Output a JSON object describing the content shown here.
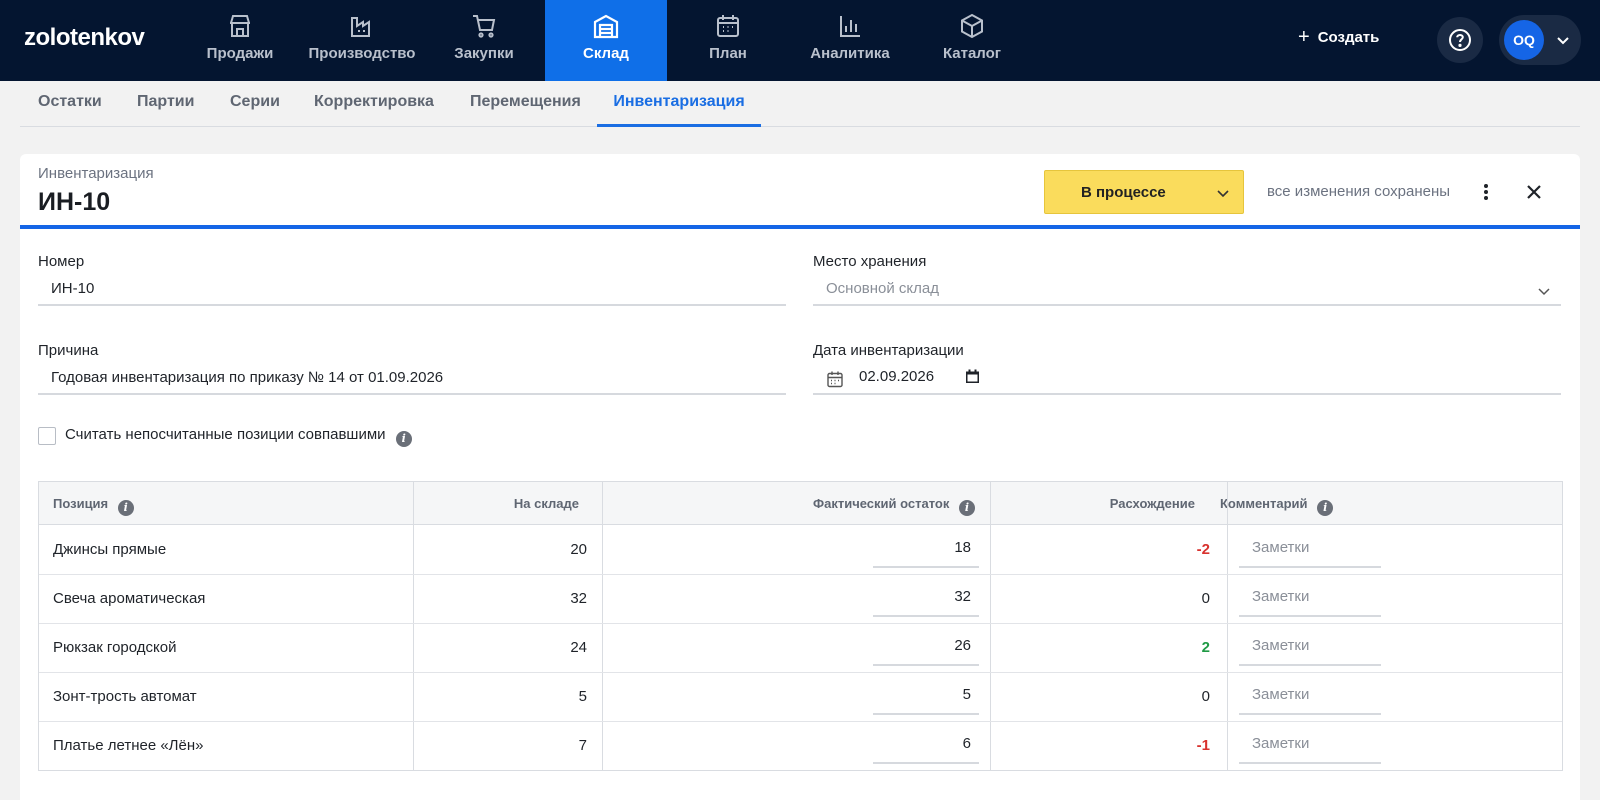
{
  "brand": "zolotenkov",
  "nav": [
    {
      "label": "Продажи",
      "icon": "store-icon"
    },
    {
      "label": "Производство",
      "icon": "factory-icon"
    },
    {
      "label": "Закупки",
      "icon": "cart-icon"
    },
    {
      "label": "Склад",
      "icon": "warehouse-icon",
      "active": true
    },
    {
      "label": "План",
      "icon": "calendar-icon"
    },
    {
      "label": "Аналитика",
      "icon": "bar-chart-icon"
    },
    {
      "label": "Каталог",
      "icon": "box-icon"
    }
  ],
  "header": {
    "create_label": "Создать",
    "avatar_initials": "OQ"
  },
  "subtabs": [
    "Остатки",
    "Партии",
    "Серии",
    "Корректировка",
    "Перемещения",
    "Инвентаризация"
  ],
  "active_subtab": "Инвентаризация",
  "doc": {
    "type_label": "Инвентаризация",
    "title": "ИН-10",
    "status": "В процессе",
    "status_color": "#fadc5c",
    "saved_text": "все изменения сохранены"
  },
  "form": {
    "number_label": "Номер",
    "number_value": "ИН-10",
    "storage_label": "Место хранения",
    "storage_placeholder": "Основной склад",
    "reason_label": "Причина",
    "reason_value": "Годовая инвентаризация по приказу № 14 от 01.09.2026",
    "date_label": "Дата инвентаризации",
    "date_value": "02.09.2026",
    "checkbox_label": "Считать непосчитанные позиции совпавшими",
    "checkbox_checked": false
  },
  "table": {
    "headers": {
      "position": "Позиция",
      "in_stock": "На складе",
      "actual": "Фактический остаток",
      "diff": "Расхождение",
      "comment": "Комментарий"
    },
    "note_placeholder": "Заметки",
    "rows": [
      {
        "name": "Джинсы прямые",
        "in_stock": "20",
        "actual": "18",
        "diff": "-2"
      },
      {
        "name": "Свеча ароматическая",
        "in_stock": "32",
        "actual": "32",
        "diff": "0"
      },
      {
        "name": "Рюкзак городской",
        "in_stock": "24",
        "actual": "26",
        "diff": "2"
      },
      {
        "name": "Зонт-трость автомат",
        "in_stock": "5",
        "actual": "5",
        "diff": "0"
      },
      {
        "name": "Платье летнее «Лён»",
        "in_stock": "7",
        "actual": "6",
        "diff": "-1"
      }
    ]
  },
  "colors": {
    "nav_bg": "#041530",
    "accent": "#1565e6",
    "negative": "#d8322e",
    "positive": "#1f9a45"
  }
}
